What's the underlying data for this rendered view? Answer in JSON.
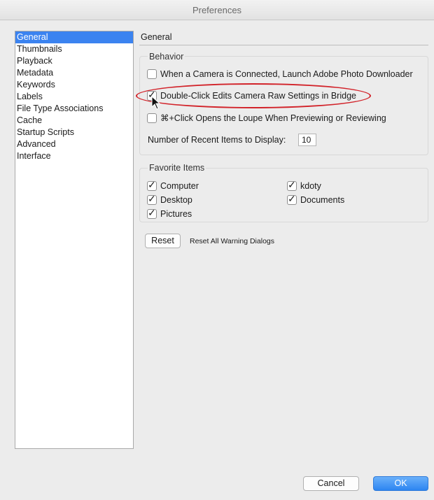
{
  "window": {
    "title": "Preferences"
  },
  "sidebar": {
    "items": [
      {
        "label": "General",
        "selected": true
      },
      {
        "label": "Thumbnails"
      },
      {
        "label": "Playback"
      },
      {
        "label": "Metadata"
      },
      {
        "label": "Keywords"
      },
      {
        "label": "Labels"
      },
      {
        "label": "File Type Associations"
      },
      {
        "label": "Cache"
      },
      {
        "label": "Startup Scripts"
      },
      {
        "label": "Advanced"
      },
      {
        "label": "Interface"
      }
    ]
  },
  "pane": {
    "title": "General",
    "behavior": {
      "label": "Behavior",
      "options": [
        {
          "label": "When a Camera is Connected, Launch Adobe Photo Downloader",
          "checked": false
        },
        {
          "label": "Double-Click Edits Camera Raw Settings in Bridge",
          "checked": true
        },
        {
          "label": "⌘+Click Opens the Loupe When Previewing or Reviewing",
          "checked": false
        }
      ],
      "recent_items_label": "Number of Recent Items to Display:",
      "recent_items_value": "10"
    },
    "favorites": {
      "label": "Favorite Items",
      "items": [
        {
          "label": "Computer",
          "checked": true
        },
        {
          "label": "kdoty",
          "checked": true
        },
        {
          "label": "Desktop",
          "checked": true
        },
        {
          "label": "Documents",
          "checked": true
        },
        {
          "label": "Pictures",
          "checked": true
        }
      ]
    },
    "reset_button": "Reset",
    "reset_label": "Reset All Warning Dialogs"
  },
  "footer": {
    "cancel": "Cancel",
    "ok": "OK"
  },
  "colors": {
    "selection": "#3b83f0",
    "annotation": "#d2232a",
    "primary_button": "#2d85f1"
  },
  "icons": {
    "checkmark": "checkmark-icon",
    "cursor": "mouse-pointer-icon"
  }
}
